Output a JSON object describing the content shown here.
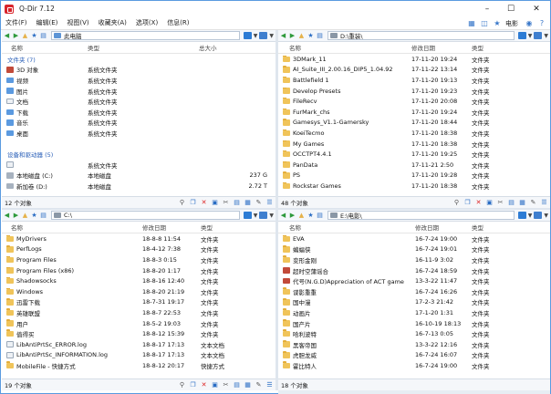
{
  "app": {
    "title": "Q-Dir 7.12"
  },
  "window_controls": {
    "minimize": "–",
    "maximize": "☐",
    "close": "✕"
  },
  "menu": {
    "items": [
      "文件(F)",
      "编辑(E)",
      "视图(V)",
      "收藏夹(A)",
      "选项(X)",
      "信息(R)"
    ],
    "right_label": "电影"
  },
  "panes": {
    "tl": {
      "address": "此电脑",
      "columns": [
        "名称",
        "类型",
        "总大小"
      ],
      "groups": [
        {
          "title": "文件夹 (7)",
          "items": [
            {
              "name": "3D 对象",
              "type": "系统文件夹",
              "size": ""
            },
            {
              "name": "视频",
              "type": "系统文件夹",
              "size": ""
            },
            {
              "name": "图片",
              "type": "系统文件夹",
              "size": ""
            },
            {
              "name": "文档",
              "type": "系统文件夹",
              "size": ""
            },
            {
              "name": "下载",
              "type": "系统文件夹",
              "size": ""
            },
            {
              "name": "音乐",
              "type": "系统文件夹",
              "size": ""
            },
            {
              "name": "桌面",
              "type": "系统文件夹",
              "size": ""
            }
          ]
        },
        {
          "title": "设备和驱动器 (5)",
          "items": [
            {
              "name": "",
              "type": "系统文件夹",
              "size": ""
            },
            {
              "name": "本地磁盘 (C:)",
              "type": "本地磁盘",
              "size": "237 G"
            },
            {
              "name": "新加卷 (D:)",
              "type": "本地磁盘",
              "size": "2.72 T"
            }
          ]
        }
      ],
      "status": "12 个对象"
    },
    "tr": {
      "address": "D:\\重装\\",
      "columns": [
        "名称",
        "修改日期",
        "类型"
      ],
      "rows": [
        {
          "name": "3DMark_11",
          "date": "17-11-20 19:24",
          "type": "文件夹"
        },
        {
          "name": "AI_Suite_III_2.00.16_DIP5_1.04.92",
          "date": "17-11-22 13:14",
          "type": "文件夹"
        },
        {
          "name": "Battlefield 1",
          "date": "17-11-20 19:13",
          "type": "文件夹"
        },
        {
          "name": "Develop Presets",
          "date": "17-11-20 19:23",
          "type": "文件夹"
        },
        {
          "name": "FileRecv",
          "date": "17-11-20 20:08",
          "type": "文件夹"
        },
        {
          "name": "FurMark_chs",
          "date": "17-11-20 19:24",
          "type": "文件夹"
        },
        {
          "name": "Gamesys_V1.1-Gamersky",
          "date": "17-11-20 18:44",
          "type": "文件夹"
        },
        {
          "name": "KoeiTecmo",
          "date": "17-11-20 18:38",
          "type": "文件夹"
        },
        {
          "name": "My Games",
          "date": "17-11-20 18:38",
          "type": "文件夹"
        },
        {
          "name": "OCCTPT4.4.1",
          "date": "17-11-20 19:25",
          "type": "文件夹"
        },
        {
          "name": "PanData",
          "date": "17-11-21 2:50",
          "type": "文件夹"
        },
        {
          "name": "PS",
          "date": "17-11-20 19:28",
          "type": "文件夹"
        },
        {
          "name": "Rockstar Games",
          "date": "17-11-20 18:38",
          "type": "文件夹"
        }
      ],
      "status": "48 个对象"
    },
    "bl": {
      "address": "C:\\",
      "columns": [
        "名称",
        "修改日期",
        "类型"
      ],
      "rows": [
        {
          "name": "MyDrivers",
          "date": "18-8-8 11:54",
          "type": "文件夹",
          "kind": "folder"
        },
        {
          "name": "PerfLogs",
          "date": "18-4-12 7:38",
          "type": "文件夹",
          "kind": "folder"
        },
        {
          "name": "Program Files",
          "date": "18-8-3 0:15",
          "type": "文件夹",
          "kind": "folder"
        },
        {
          "name": "Program Files (x86)",
          "date": "18-8-20 1:17",
          "type": "文件夹",
          "kind": "folder"
        },
        {
          "name": "Shadowsocks",
          "date": "18-8-16 12:40",
          "type": "文件夹",
          "kind": "folder"
        },
        {
          "name": "Windows",
          "date": "18-8-20 21:19",
          "type": "文件夹",
          "kind": "folder"
        },
        {
          "name": "迅雷下载",
          "date": "18-7-31 19:17",
          "type": "文件夹",
          "kind": "folder"
        },
        {
          "name": "英雄联盟",
          "date": "18-8-7 22:53",
          "type": "文件夹",
          "kind": "folder"
        },
        {
          "name": "用户",
          "date": "18-5-2 19:03",
          "type": "文件夹",
          "kind": "folder"
        },
        {
          "name": "值得买",
          "date": "18-8-12 15:39",
          "type": "文件夹",
          "kind": "folder"
        },
        {
          "name": "LibAntiPrtSc_ERROR.log",
          "date": "18-8-17 17:13",
          "type": "文本文档",
          "kind": "file"
        },
        {
          "name": "LibAntiPrtSc_INFORMATION.log",
          "date": "18-8-17 17:13",
          "type": "文本文档",
          "kind": "file"
        },
        {
          "name": "MobileFile - 快捷方式",
          "date": "18-8-12 20:17",
          "type": "快捷方式",
          "kind": "shortcut"
        }
      ],
      "status": "19 个对象"
    },
    "br": {
      "address": "E:\\电影\\",
      "columns": [
        "名称",
        "修改日期",
        "类型"
      ],
      "rows": [
        {
          "name": "EVA",
          "date": "16-7-24 19:00",
          "type": "文件夹",
          "kind": "folder"
        },
        {
          "name": "蝙蝠侠",
          "date": "16-7-24 19:01",
          "type": "文件夹",
          "kind": "folder"
        },
        {
          "name": "变形金刚",
          "date": "16-11-9 3:02",
          "type": "文件夹",
          "kind": "folder"
        },
        {
          "name": "超时空蒲谣合",
          "date": "16-7-24 18:59",
          "type": "文件夹",
          "kind": "game"
        },
        {
          "name": "代号(N.G.D)Appreciation of ACT game",
          "date": "13-3-22 11:47",
          "type": "文件夹",
          "kind": "game"
        },
        {
          "name": "谍影重重",
          "date": "16-7-24 16:26",
          "type": "文件夹",
          "kind": "folder"
        },
        {
          "name": "国中漫",
          "date": "17-2-3 21:42",
          "type": "文件夹",
          "kind": "folder"
        },
        {
          "name": "动画片",
          "date": "17-1-20 1:31",
          "type": "文件夹",
          "kind": "folder"
        },
        {
          "name": "国产片",
          "date": "16-10-19 18:13",
          "type": "文件夹",
          "kind": "folder"
        },
        {
          "name": "哈利波特",
          "date": "16-7-13 0:05",
          "type": "文件夹",
          "kind": "folder"
        },
        {
          "name": "黑客帝国",
          "date": "13-3-22 12:16",
          "type": "文件夹",
          "kind": "folder"
        },
        {
          "name": "虎胆龙威",
          "date": "16-7-24 16:07",
          "type": "文件夹",
          "kind": "folder"
        },
        {
          "name": "霍比特人",
          "date": "16-7-24 19:00",
          "type": "文件夹",
          "kind": "folder"
        }
      ],
      "status": "18 个对象"
    }
  },
  "icons": {
    "back": "back-arrow-icon",
    "forward": "forward-arrow-icon",
    "up": "up-arrow-icon",
    "favorites": "star-icon",
    "view": "view-icon",
    "delete": "delete-x-icon",
    "cut": "scissors-icon",
    "copy": "copy-icon",
    "properties": "properties-icon",
    "filter": "filter-icon",
    "pen": "pen-icon"
  },
  "colors": {
    "accent": "#2d7cd5",
    "folder": "#f0c45a",
    "group_header": "#2b60b8",
    "delete": "#dd2222"
  }
}
